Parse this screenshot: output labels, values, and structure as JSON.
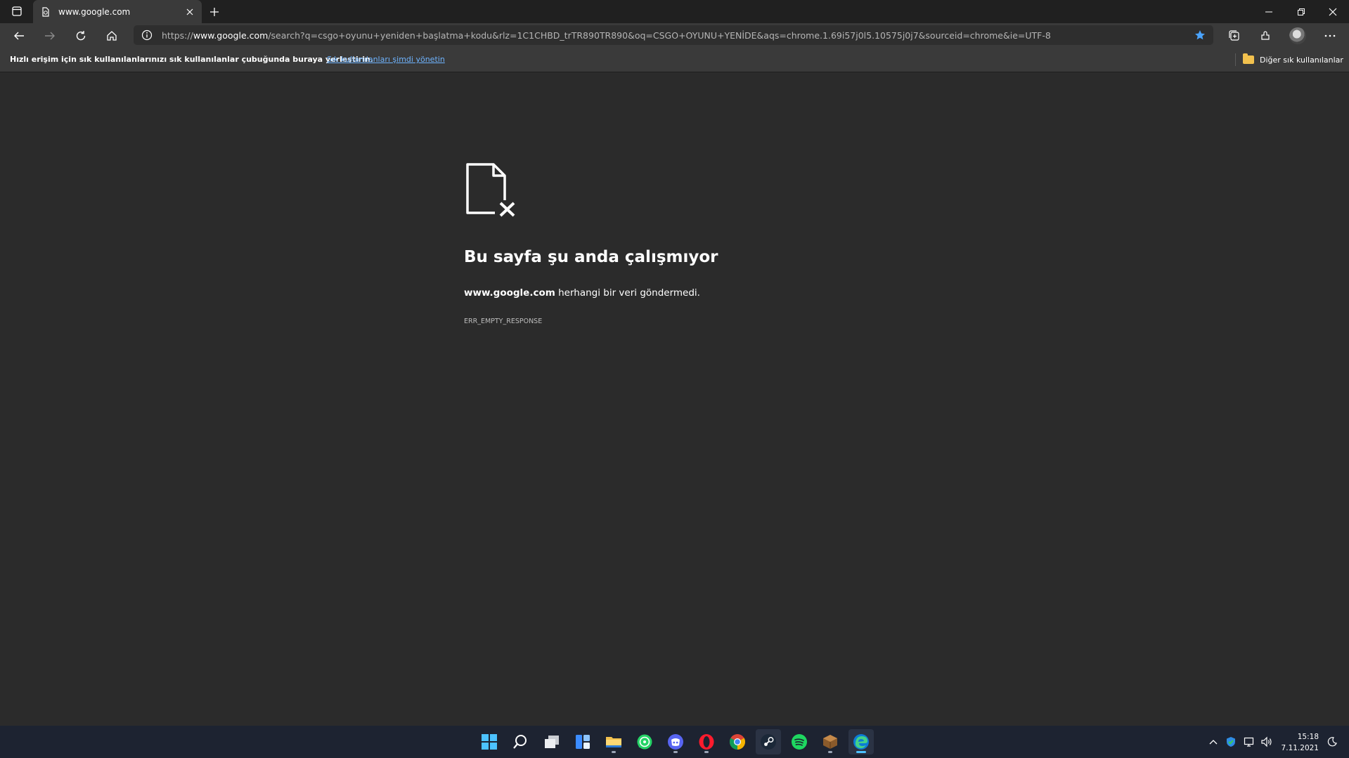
{
  "browser": {
    "tab": {
      "title": "www.google.com",
      "favicon": "page-broken-icon"
    },
    "toolbar": {
      "url_scheme": "https://",
      "url_host": "www.google.com",
      "url_path": "/search?q=csgo+oyunu+yeniden+başlatma+kodu&rlz=1C1CHBD_trTR890TR890&oq=CSGO+OYUNU+YENİDE&aqs=chrome.1.69i57j0l5.10575j0j7&sourceid=chrome&ie=UTF-8"
    },
    "favorites_bar": {
      "message": "Hızlı erişim için sık kullanılanlarınızı sık kullanılanlar çubuğunda buraya yerleştirin.",
      "manage_link": "Sık kullanılanları şimdi yönetin",
      "other_favorites": "Diğer sık kullanılanlar"
    }
  },
  "error_page": {
    "title": "Bu sayfa şu anda çalışmıyor",
    "host": "www.google.com",
    "description_suffix": " herhangi bir veri göndermedi.",
    "code": "ERR_EMPTY_RESPONSE"
  },
  "taskbar": {
    "apps": [
      "start-icon",
      "search-icon",
      "task-view-icon",
      "widgets-icon",
      "file-explorer-icon",
      "whatsapp-icon",
      "discord-icon",
      "opera-icon",
      "chrome-icon",
      "steam-icon",
      "spotify-icon",
      "minecraft-icon",
      "edge-icon"
    ],
    "clock": {
      "time": "15:18",
      "date": "7.11.2021"
    }
  },
  "colors": {
    "accent_link": "#6fb4ff",
    "star": "#4aa3ff",
    "background": "#2b2b2b"
  }
}
